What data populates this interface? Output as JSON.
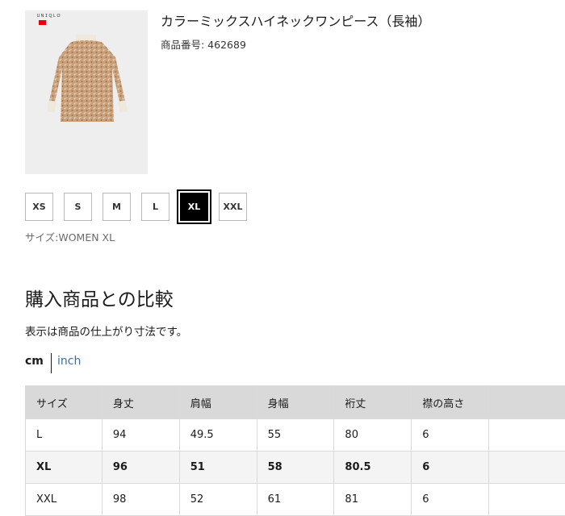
{
  "product": {
    "title": "カラーミックスハイネックワンピース（長袖）",
    "code": "商品番号: 462689",
    "logo_text": "ＵＮＩＱＬＯ"
  },
  "sizes": [
    {
      "label": "XS",
      "selected": false
    },
    {
      "label": "S",
      "selected": false
    },
    {
      "label": "M",
      "selected": false
    },
    {
      "label": "L",
      "selected": false
    },
    {
      "label": "XL",
      "selected": true
    },
    {
      "label": "XXL",
      "selected": false
    }
  ],
  "size_caption": "サイズ:WOMEN XL",
  "comparison": {
    "heading": "購入商品との比較",
    "note": "表示は商品の仕上がり寸法です。",
    "units": {
      "cm": "cm",
      "inch": "inch",
      "active": "cm"
    },
    "headers": [
      "サイズ",
      "身丈",
      "肩幅",
      "身幅",
      "裄丈",
      "襟の高さ"
    ],
    "rows": [
      [
        "L",
        "94",
        "49.5",
        "55",
        "80",
        "6"
      ],
      [
        "XL",
        "96",
        "51",
        "58",
        "80.5",
        "6"
      ],
      [
        "XXL",
        "98",
        "52",
        "61",
        "81",
        "6"
      ]
    ]
  },
  "colors": {
    "accent_link": "#3a6ea5",
    "selected_chip": "#000000",
    "header_bg": "#d9d9d9",
    "logo_red": "#e60012"
  }
}
